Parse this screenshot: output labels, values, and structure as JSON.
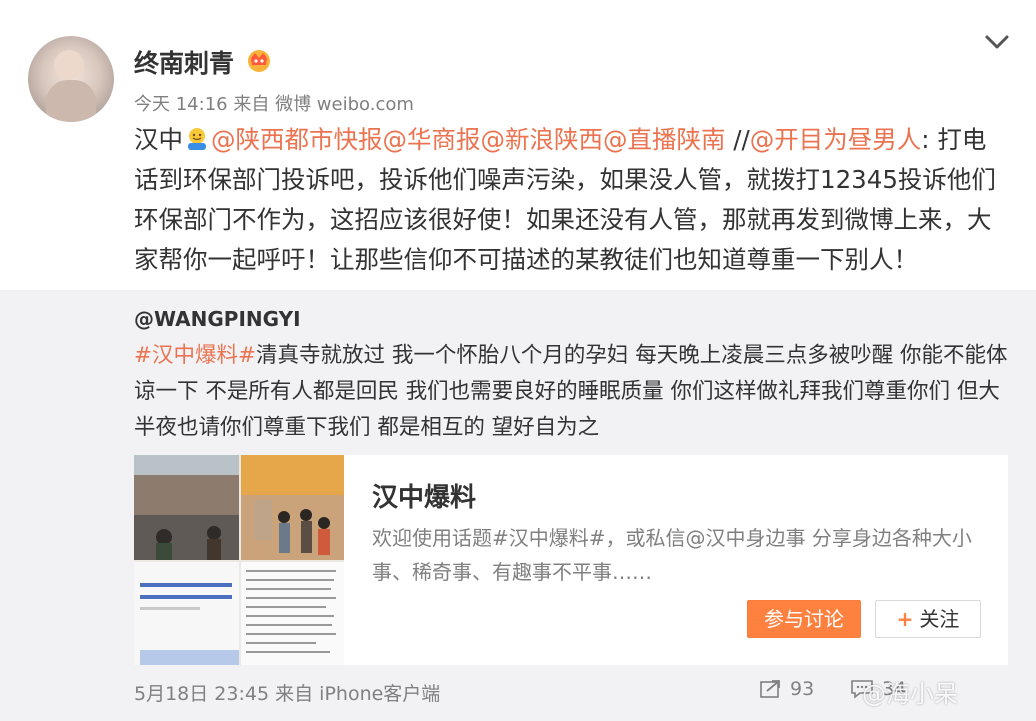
{
  "post": {
    "username": "终南刺青",
    "time": "今天 14:16",
    "source_prefix": "来自",
    "source": "微博 weibo.com",
    "text_parts": {
      "p1": "汉中",
      "m1": "@陕西都市快报",
      "m2": "@华商报",
      "m3": "@新浪陕西",
      "m4": "@直播陕南",
      "sep": " //",
      "m5": "@开目为昼男人",
      "body": ": 打电话到环保部门投诉吧，投诉他们噪声污染，如果没人管，就拨打12345投诉他们环保部门不作为，这招应该很好使！如果还没有人管，那就再发到微博上来，大家帮你一起呼吁！让那些信仰不可描述的某教徒们也知道尊重一下别人！"
    }
  },
  "repost": {
    "username": "@WANGPINGYI",
    "topic": "#汉中爆料#",
    "text": "清真寺就放过 我一个怀胎八个月的孕妇 每天晚上凌晨三点多被吵醒 你能不能体谅一下 不是所有人都是回民 我们也需要良好的睡眠质量 你们这样做礼拜我们尊重你们 但大半夜也请你们尊重下我们 都是相互的 望好自为之",
    "topic_card": {
      "title": "汉中爆料",
      "description": "欢迎使用话题#汉中爆料#，或私信@汉中身边事 分享身边各种大小事、稀奇事、有趣事不平事……",
      "discuss_label": "参与讨论",
      "follow_label": "关注"
    },
    "footer": {
      "date": "5月18日 23:45",
      "source_prefix": "来自",
      "source": "iPhone客户端",
      "forward_count": "93",
      "comment_count": "34"
    }
  },
  "watermark": "@海小呆",
  "colors": {
    "link": "#eb7350",
    "accent": "#ff8140",
    "repost_bg": "#f2f2f5"
  }
}
